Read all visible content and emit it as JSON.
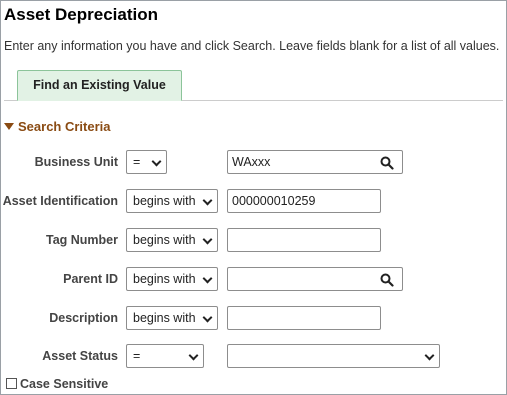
{
  "page": {
    "title": "Asset Depreciation",
    "instructions": "Enter any information you have and click Search. Leave fields blank for a list of all values."
  },
  "tabs": [
    {
      "label": "Find an Existing Value",
      "active": true
    }
  ],
  "search_criteria": {
    "header": "Search Criteria",
    "fields": [
      {
        "label": "Business Unit",
        "operator": "=",
        "value": "WAxxx",
        "lookup": true
      },
      {
        "label": "Asset Identification",
        "operator": "begins with",
        "value": "000000010259",
        "lookup": false
      },
      {
        "label": "Tag Number",
        "operator": "begins with",
        "value": "",
        "lookup": false
      },
      {
        "label": "Parent ID",
        "operator": "begins with",
        "value": "",
        "lookup": true
      },
      {
        "label": "Description",
        "operator": "begins with",
        "value": "",
        "lookup": false
      },
      {
        "label": "Asset Status",
        "operator": "=",
        "value": "",
        "lookup": false,
        "dropdown": true
      }
    ],
    "case_sensitive_label": "Case Sensitive",
    "case_sensitive_checked": false
  },
  "colors": {
    "tab_background": "#e2f2e5",
    "section_header": "#8a4b13"
  }
}
